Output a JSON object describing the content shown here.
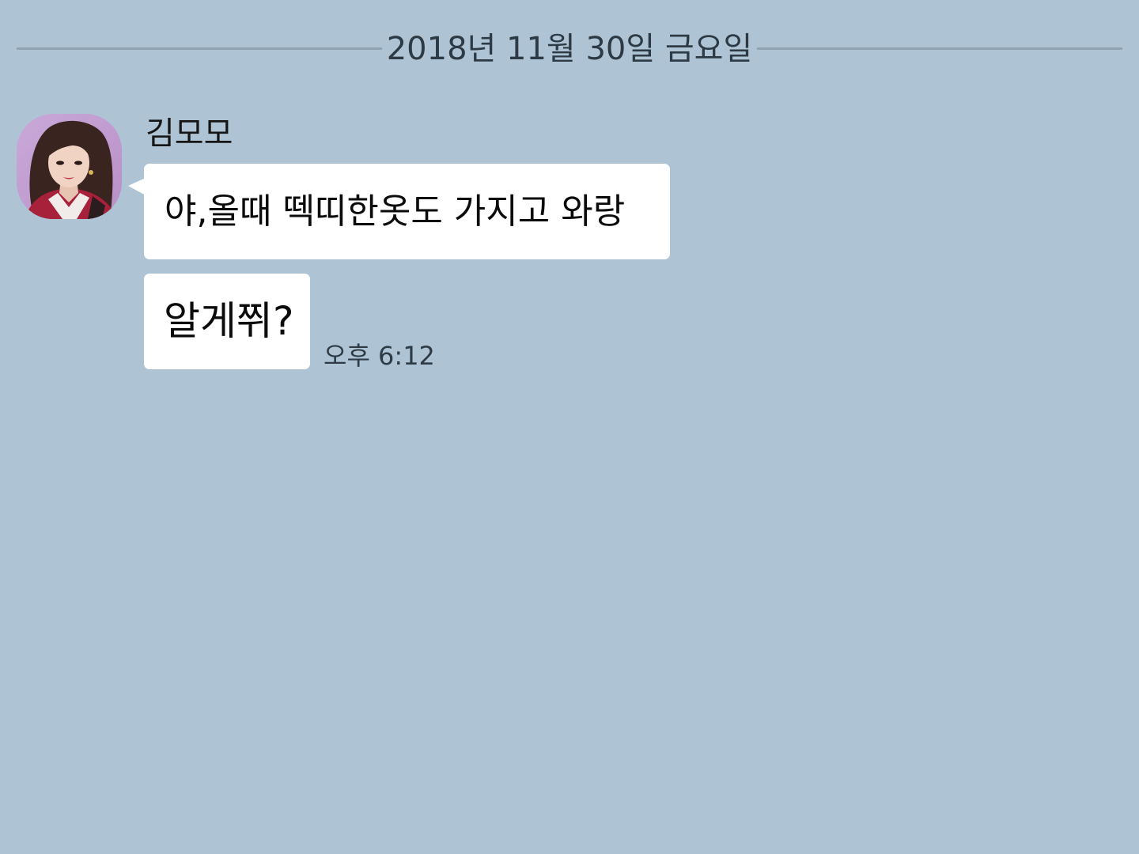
{
  "date_divider": {
    "text": "2018년 11월 30일 금요일"
  },
  "chat": {
    "sender": {
      "name": "김모모",
      "avatar_icon": "profile-photo"
    },
    "messages": [
      {
        "text": "야,올때 떽띠한옷도 가지고 와랑"
      },
      {
        "text": "알게쮜?"
      }
    ],
    "timestamp": "오후 6:12"
  },
  "colors": {
    "background": "#aec4d5",
    "bubble": "#ffffff",
    "divider_line": "#8fa3b3"
  }
}
